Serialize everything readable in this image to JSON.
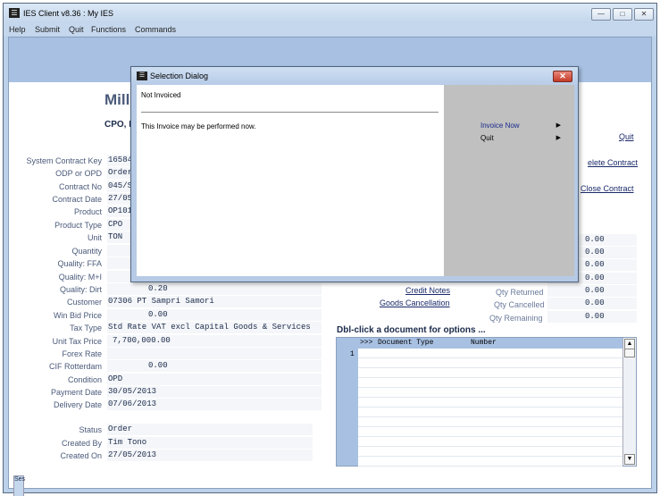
{
  "window": {
    "title": "IES Client v8.36 : My IES"
  },
  "menu": [
    "Help",
    "Submit",
    "Quit",
    "Functions",
    "Commands"
  ],
  "header": {
    "title": "Mill",
    "subtitle": "CPO, F"
  },
  "fields": [
    {
      "label": "System Contract Key",
      "value": "165848"
    },
    {
      "label": "ODP or OPD",
      "value": "Order,"
    },
    {
      "label": "Contract No",
      "value": "045/SP"
    },
    {
      "label": "Contract Date",
      "value": "27/05/"
    },
    {
      "label": "Product",
      "value": "OP101"
    },
    {
      "label": "Product Type",
      "value": "CPO"
    },
    {
      "label": "Unit",
      "value": "TON"
    },
    {
      "label": "Quantity",
      "value": ""
    },
    {
      "label": "Quality: FFA",
      "value": ""
    },
    {
      "label": "Quality: M+I",
      "value": ""
    },
    {
      "label": "Quality: Dirt",
      "value": "0.20"
    },
    {
      "label": "Customer",
      "value": "07306 PT Sampri Samori"
    },
    {
      "label": "Win Bid Price",
      "value": "0.00"
    },
    {
      "label": "Tax Type",
      "value": "Std Rate VAT excl Capital Goods & Services"
    },
    {
      "label": "Unit Tax Price",
      "value": "7,700,000.00"
    },
    {
      "label": "Forex Rate",
      "value": ""
    },
    {
      "label": "CIF Rotterdam",
      "value": "0.00"
    },
    {
      "label": "Condition",
      "value": "OPD"
    },
    {
      "label": "Payment Date",
      "value": "30/05/2013"
    },
    {
      "label": "Delivery Date",
      "value": "07/06/2013"
    },
    {
      "label": "Status",
      "value": "Order"
    },
    {
      "label": "Created By",
      "value": "Tim Tono"
    },
    {
      "label": "Created On",
      "value": "27/05/2013"
    }
  ],
  "links": {
    "quit": "Quit",
    "delete_contract": "elete Contract",
    "close_contract": "Close Contract",
    "credit_notes": "Credit Notes",
    "goods_cancellation": "Goods Cancellation"
  },
  "quantities": [
    {
      "label": "",
      "value": "0.00"
    },
    {
      "label": "",
      "value": "0.00"
    },
    {
      "label": "",
      "value": "0.00"
    },
    {
      "label": "",
      "value": "0.00"
    },
    {
      "label": "Qty Returned",
      "value": "0.00"
    },
    {
      "label": "Qty Cancelled",
      "value": "0.00"
    },
    {
      "label": "Qty Remaining",
      "value": "0.00"
    }
  ],
  "documents": {
    "title": "Dbl-click a document for options ...",
    "header": {
      "marker": ">>>",
      "type": "Document Type",
      "number": "Number"
    },
    "row_numbers": [
      "1"
    ],
    "scroll_up": "▲",
    "scroll_down": "▼"
  },
  "session": "Ses",
  "dialog": {
    "title": "Selection Dialog",
    "close": "✕",
    "heading": "Not Invoiced",
    "message": "This Invoice may be performed now.",
    "options": [
      {
        "label": "Invoice Now",
        "color": "#1a2a8a"
      },
      {
        "label": "Quit",
        "color": "#000000"
      }
    ]
  }
}
